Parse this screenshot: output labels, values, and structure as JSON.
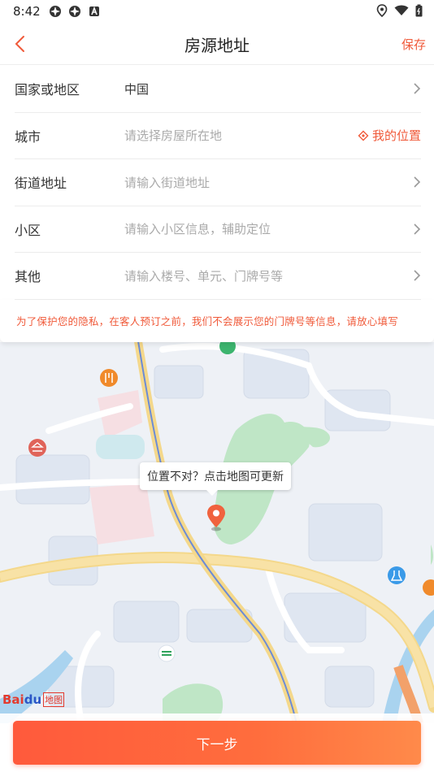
{
  "status_bar": {
    "time": "8:42"
  },
  "nav": {
    "title": "房源地址",
    "save_label": "保存"
  },
  "form": {
    "rows": [
      {
        "label": "国家或地区",
        "value": "中国",
        "is_placeholder": false
      },
      {
        "label": "城市",
        "value": "请选择房屋所在地",
        "is_placeholder": true,
        "action": "我的位置"
      },
      {
        "label": "街道地址",
        "value": "请输入街道地址",
        "is_placeholder": true
      },
      {
        "label": "小区",
        "value": "请输入小区信息，辅助定位",
        "is_placeholder": true
      },
      {
        "label": "其他",
        "value": "请输入楼号、单元、门牌号等",
        "is_placeholder": true
      }
    ],
    "privacy_note": "为了保护您的隐私，在客人预订之前，我们不会展示您的门牌号等信息，请放心填写"
  },
  "map": {
    "tooltip": "位置不对？点击地图可更新",
    "logo_text_bai": "Bai",
    "logo_text_du": "du",
    "logo_text_map": "地图"
  },
  "bottom": {
    "next_label": "下一步"
  },
  "colors": {
    "accent": "#f05a3a",
    "button_start": "#ff5a3c",
    "button_end": "#ff8a4a"
  }
}
